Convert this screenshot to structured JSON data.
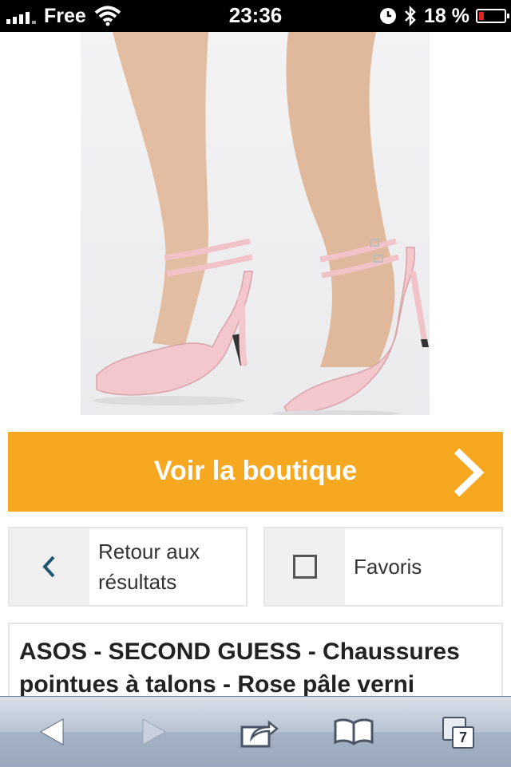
{
  "status_bar": {
    "carrier": "Free",
    "time": "23:36",
    "battery": "18 %",
    "battery_level": 0.18,
    "icons": [
      "signal-icon",
      "wifi-icon",
      "alarm-icon",
      "bluetooth-icon",
      "battery-icon"
    ]
  },
  "product_image": {
    "colors": {
      "shoe": "#f4c8cc",
      "skin": "#e2bca0",
      "background": "#efeff1"
    }
  },
  "shop_button": {
    "label": "Voir la boutique",
    "color": "#f6a821",
    "icon": "chevron-right-icon"
  },
  "actions": {
    "back_label": "Retour aux résultats",
    "back_icon": "chevron-left-icon",
    "favorites_label": "Favoris",
    "favorites_icon": "checkbox-icon"
  },
  "product": {
    "title": "ASOS - SECOND GUESS - Chaussures pointues à talons - Rose pâle verni"
  },
  "toolbar": {
    "tabs_count": "7",
    "icons": [
      "back-arrow-icon",
      "forward-arrow-icon",
      "share-icon",
      "bookmarks-icon",
      "tabs-icon"
    ]
  }
}
